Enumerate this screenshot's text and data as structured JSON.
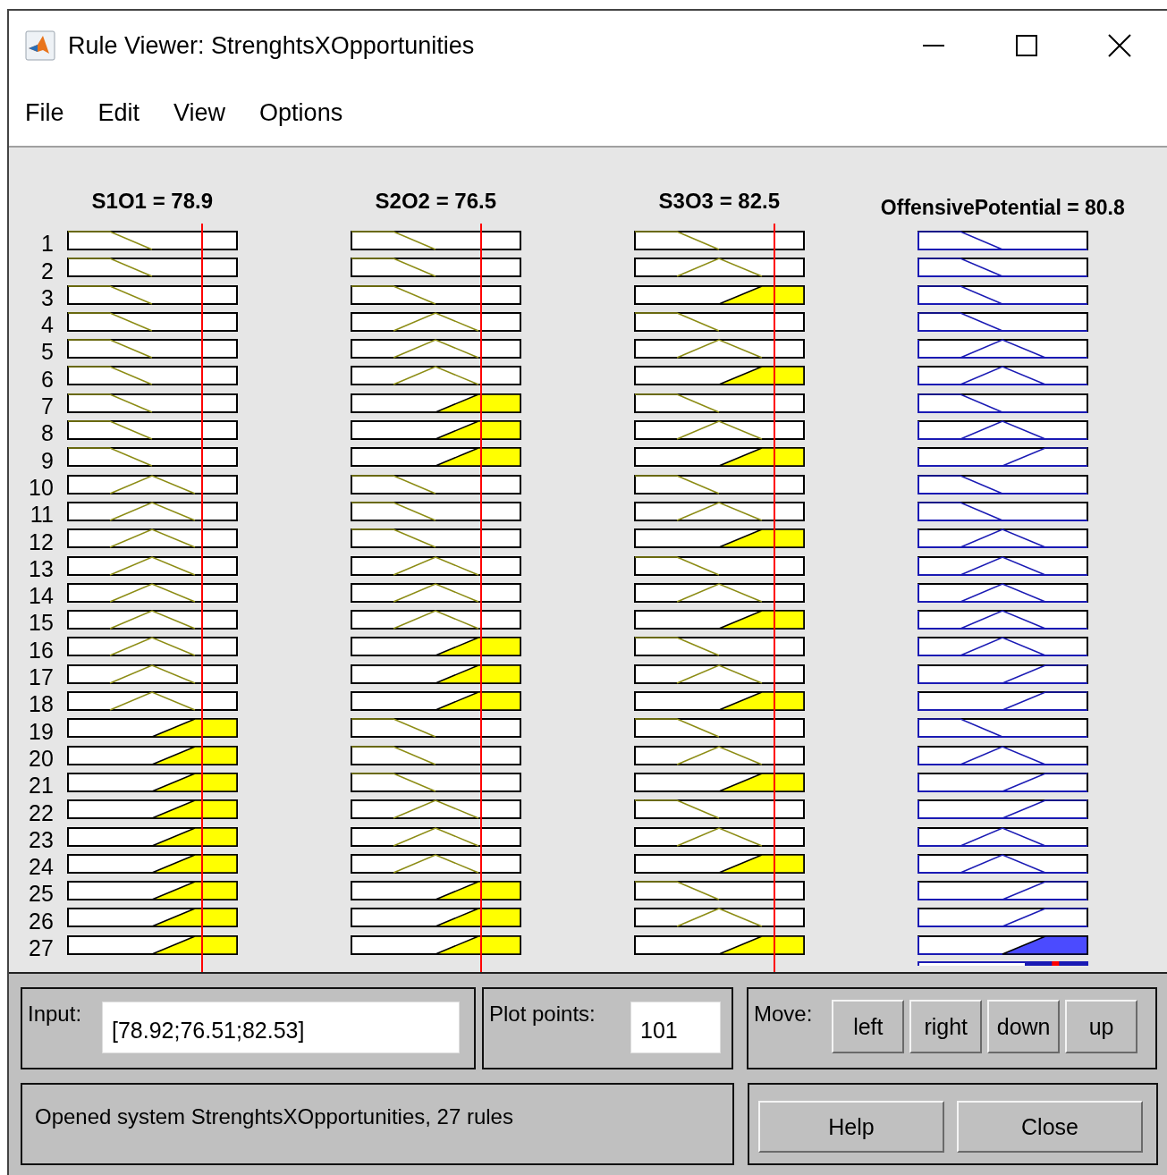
{
  "window": {
    "title": "Rule Viewer: StrenghtsXOpportunities"
  },
  "menu": [
    "File",
    "Edit",
    "View",
    "Options"
  ],
  "columns": [
    {
      "label": "S1O1 = 78.9",
      "kind": "input"
    },
    {
      "label": "S2O2 = 76.5",
      "kind": "input"
    },
    {
      "label": "S3O3 = 82.5",
      "kind": "input"
    },
    {
      "label": "OffensivePotential = 80.8",
      "kind": "output"
    }
  ],
  "rules": [
    {
      "number": "1",
      "cells": [
        {
          "kind": "low",
          "fired": false
        },
        {
          "kind": "low",
          "fired": false
        },
        {
          "kind": "low",
          "fired": false
        },
        {
          "kind": "low",
          "fired": false
        }
      ]
    },
    {
      "number": "2",
      "cells": [
        {
          "kind": "low",
          "fired": false
        },
        {
          "kind": "low",
          "fired": false
        },
        {
          "kind": "mid",
          "fired": false
        },
        {
          "kind": "low",
          "fired": false
        }
      ]
    },
    {
      "number": "3",
      "cells": [
        {
          "kind": "low",
          "fired": false
        },
        {
          "kind": "low",
          "fired": false
        },
        {
          "kind": "high",
          "fired": true
        },
        {
          "kind": "low",
          "fired": false
        }
      ]
    },
    {
      "number": "4",
      "cells": [
        {
          "kind": "low",
          "fired": false
        },
        {
          "kind": "mid",
          "fired": false
        },
        {
          "kind": "low",
          "fired": false
        },
        {
          "kind": "low",
          "fired": false
        }
      ]
    },
    {
      "number": "5",
      "cells": [
        {
          "kind": "low",
          "fired": false
        },
        {
          "kind": "mid",
          "fired": false
        },
        {
          "kind": "mid",
          "fired": false
        },
        {
          "kind": "mid",
          "fired": false
        }
      ]
    },
    {
      "number": "6",
      "cells": [
        {
          "kind": "low",
          "fired": false
        },
        {
          "kind": "mid",
          "fired": false
        },
        {
          "kind": "high",
          "fired": true
        },
        {
          "kind": "mid",
          "fired": false
        }
      ]
    },
    {
      "number": "7",
      "cells": [
        {
          "kind": "low",
          "fired": false
        },
        {
          "kind": "high",
          "fired": true
        },
        {
          "kind": "low",
          "fired": false
        },
        {
          "kind": "low",
          "fired": false
        }
      ]
    },
    {
      "number": "8",
      "cells": [
        {
          "kind": "low",
          "fired": false
        },
        {
          "kind": "high",
          "fired": true
        },
        {
          "kind": "mid",
          "fired": false
        },
        {
          "kind": "mid",
          "fired": false
        }
      ]
    },
    {
      "number": "9",
      "cells": [
        {
          "kind": "low",
          "fired": false
        },
        {
          "kind": "high",
          "fired": true
        },
        {
          "kind": "high",
          "fired": true
        },
        {
          "kind": "high",
          "fired": false
        }
      ]
    },
    {
      "number": "10",
      "cells": [
        {
          "kind": "mid",
          "fired": false
        },
        {
          "kind": "low",
          "fired": false
        },
        {
          "kind": "low",
          "fired": false
        },
        {
          "kind": "low",
          "fired": false
        }
      ]
    },
    {
      "number": "11",
      "cells": [
        {
          "kind": "mid",
          "fired": false
        },
        {
          "kind": "low",
          "fired": false
        },
        {
          "kind": "mid",
          "fired": false
        },
        {
          "kind": "low",
          "fired": false
        }
      ]
    },
    {
      "number": "12",
      "cells": [
        {
          "kind": "mid",
          "fired": false
        },
        {
          "kind": "low",
          "fired": false
        },
        {
          "kind": "high",
          "fired": true
        },
        {
          "kind": "mid",
          "fired": false
        }
      ]
    },
    {
      "number": "13",
      "cells": [
        {
          "kind": "mid",
          "fired": false
        },
        {
          "kind": "mid",
          "fired": false
        },
        {
          "kind": "low",
          "fired": false
        },
        {
          "kind": "mid",
          "fired": false
        }
      ]
    },
    {
      "number": "14",
      "cells": [
        {
          "kind": "mid",
          "fired": false
        },
        {
          "kind": "mid",
          "fired": false
        },
        {
          "kind": "mid",
          "fired": false
        },
        {
          "kind": "mid",
          "fired": false
        }
      ]
    },
    {
      "number": "15",
      "cells": [
        {
          "kind": "mid",
          "fired": false
        },
        {
          "kind": "mid",
          "fired": false
        },
        {
          "kind": "high",
          "fired": true
        },
        {
          "kind": "mid",
          "fired": false
        }
      ]
    },
    {
      "number": "16",
      "cells": [
        {
          "kind": "mid",
          "fired": false
        },
        {
          "kind": "high",
          "fired": true
        },
        {
          "kind": "low",
          "fired": false
        },
        {
          "kind": "mid",
          "fired": false
        }
      ]
    },
    {
      "number": "17",
      "cells": [
        {
          "kind": "mid",
          "fired": false
        },
        {
          "kind": "high",
          "fired": true
        },
        {
          "kind": "mid",
          "fired": false
        },
        {
          "kind": "high",
          "fired": false
        }
      ]
    },
    {
      "number": "18",
      "cells": [
        {
          "kind": "mid",
          "fired": false
        },
        {
          "kind": "high",
          "fired": true
        },
        {
          "kind": "high",
          "fired": true
        },
        {
          "kind": "high",
          "fired": false
        }
      ]
    },
    {
      "number": "19",
      "cells": [
        {
          "kind": "high",
          "fired": true
        },
        {
          "kind": "low",
          "fired": false
        },
        {
          "kind": "low",
          "fired": false
        },
        {
          "kind": "low",
          "fired": false
        }
      ]
    },
    {
      "number": "20",
      "cells": [
        {
          "kind": "high",
          "fired": true
        },
        {
          "kind": "low",
          "fired": false
        },
        {
          "kind": "mid",
          "fired": false
        },
        {
          "kind": "mid",
          "fired": false
        }
      ]
    },
    {
      "number": "21",
      "cells": [
        {
          "kind": "high",
          "fired": true
        },
        {
          "kind": "low",
          "fired": false
        },
        {
          "kind": "high",
          "fired": true
        },
        {
          "kind": "high",
          "fired": false
        }
      ]
    },
    {
      "number": "22",
      "cells": [
        {
          "kind": "high",
          "fired": true
        },
        {
          "kind": "mid",
          "fired": false
        },
        {
          "kind": "low",
          "fired": false
        },
        {
          "kind": "high",
          "fired": false
        }
      ]
    },
    {
      "number": "23",
      "cells": [
        {
          "kind": "high",
          "fired": true
        },
        {
          "kind": "mid",
          "fired": false
        },
        {
          "kind": "mid",
          "fired": false
        },
        {
          "kind": "mid",
          "fired": false
        }
      ]
    },
    {
      "number": "24",
      "cells": [
        {
          "kind": "high",
          "fired": true
        },
        {
          "kind": "mid",
          "fired": false
        },
        {
          "kind": "high",
          "fired": true
        },
        {
          "kind": "mid",
          "fired": false
        }
      ]
    },
    {
      "number": "25",
      "cells": [
        {
          "kind": "high",
          "fired": true
        },
        {
          "kind": "high",
          "fired": true
        },
        {
          "kind": "low",
          "fired": false
        },
        {
          "kind": "high",
          "fired": false
        }
      ]
    },
    {
      "number": "26",
      "cells": [
        {
          "kind": "high",
          "fired": true
        },
        {
          "kind": "high",
          "fired": true
        },
        {
          "kind": "mid",
          "fired": false
        },
        {
          "kind": "high",
          "fired": false
        }
      ]
    },
    {
      "number": "27",
      "cells": [
        {
          "kind": "high",
          "fired": true
        },
        {
          "kind": "high",
          "fired": true
        },
        {
          "kind": "high",
          "fired": true
        },
        {
          "kind": "high",
          "fired": true
        }
      ]
    }
  ],
  "input": {
    "label": "Input:",
    "value": "[78.92;76.51;82.53]"
  },
  "plot_points": {
    "label": "Plot points:",
    "value": "101"
  },
  "move": {
    "label": "Move:",
    "buttons": [
      "left",
      "right",
      "down",
      "up"
    ]
  },
  "status": "Opened system StrenghtsXOpportunities, 27 rules",
  "buttons": [
    "Help",
    "Close"
  ]
}
